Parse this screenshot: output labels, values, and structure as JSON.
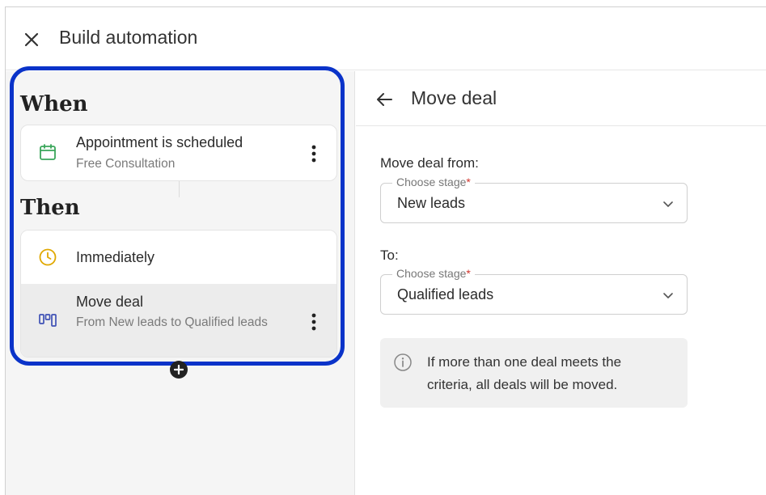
{
  "window": {
    "title": "Build automation"
  },
  "automation": {
    "when_heading": "When",
    "trigger": {
      "title": "Appointment is scheduled",
      "subtitle": "Free Consultation"
    },
    "then_heading": "Then",
    "steps": [
      {
        "title": "Immediately"
      },
      {
        "title": "Move deal",
        "subtitle": "From New leads to Qualified leads"
      }
    ]
  },
  "panel": {
    "title": "Move deal",
    "from": {
      "label": "Move deal from:",
      "legend": "Choose stage",
      "value": "New leads"
    },
    "to": {
      "label": "To:",
      "legend": "Choose stage",
      "value": "Qualified leads"
    },
    "required_marker": "*",
    "info": "If more than one deal meets the criteria, all deals will be moved."
  },
  "colors": {
    "highlight": "#0a33c9",
    "calendar_icon": "#3aa65a",
    "clock_icon": "#e0a800",
    "move_icon": "#3f51b5",
    "required": "#d0342c"
  },
  "icons": [
    "close-icon",
    "calendar-icon",
    "kebab-icon",
    "clock-icon",
    "pipeline-icon",
    "plus-icon",
    "arrow-left-icon",
    "chevron-down-icon",
    "info-icon"
  ]
}
